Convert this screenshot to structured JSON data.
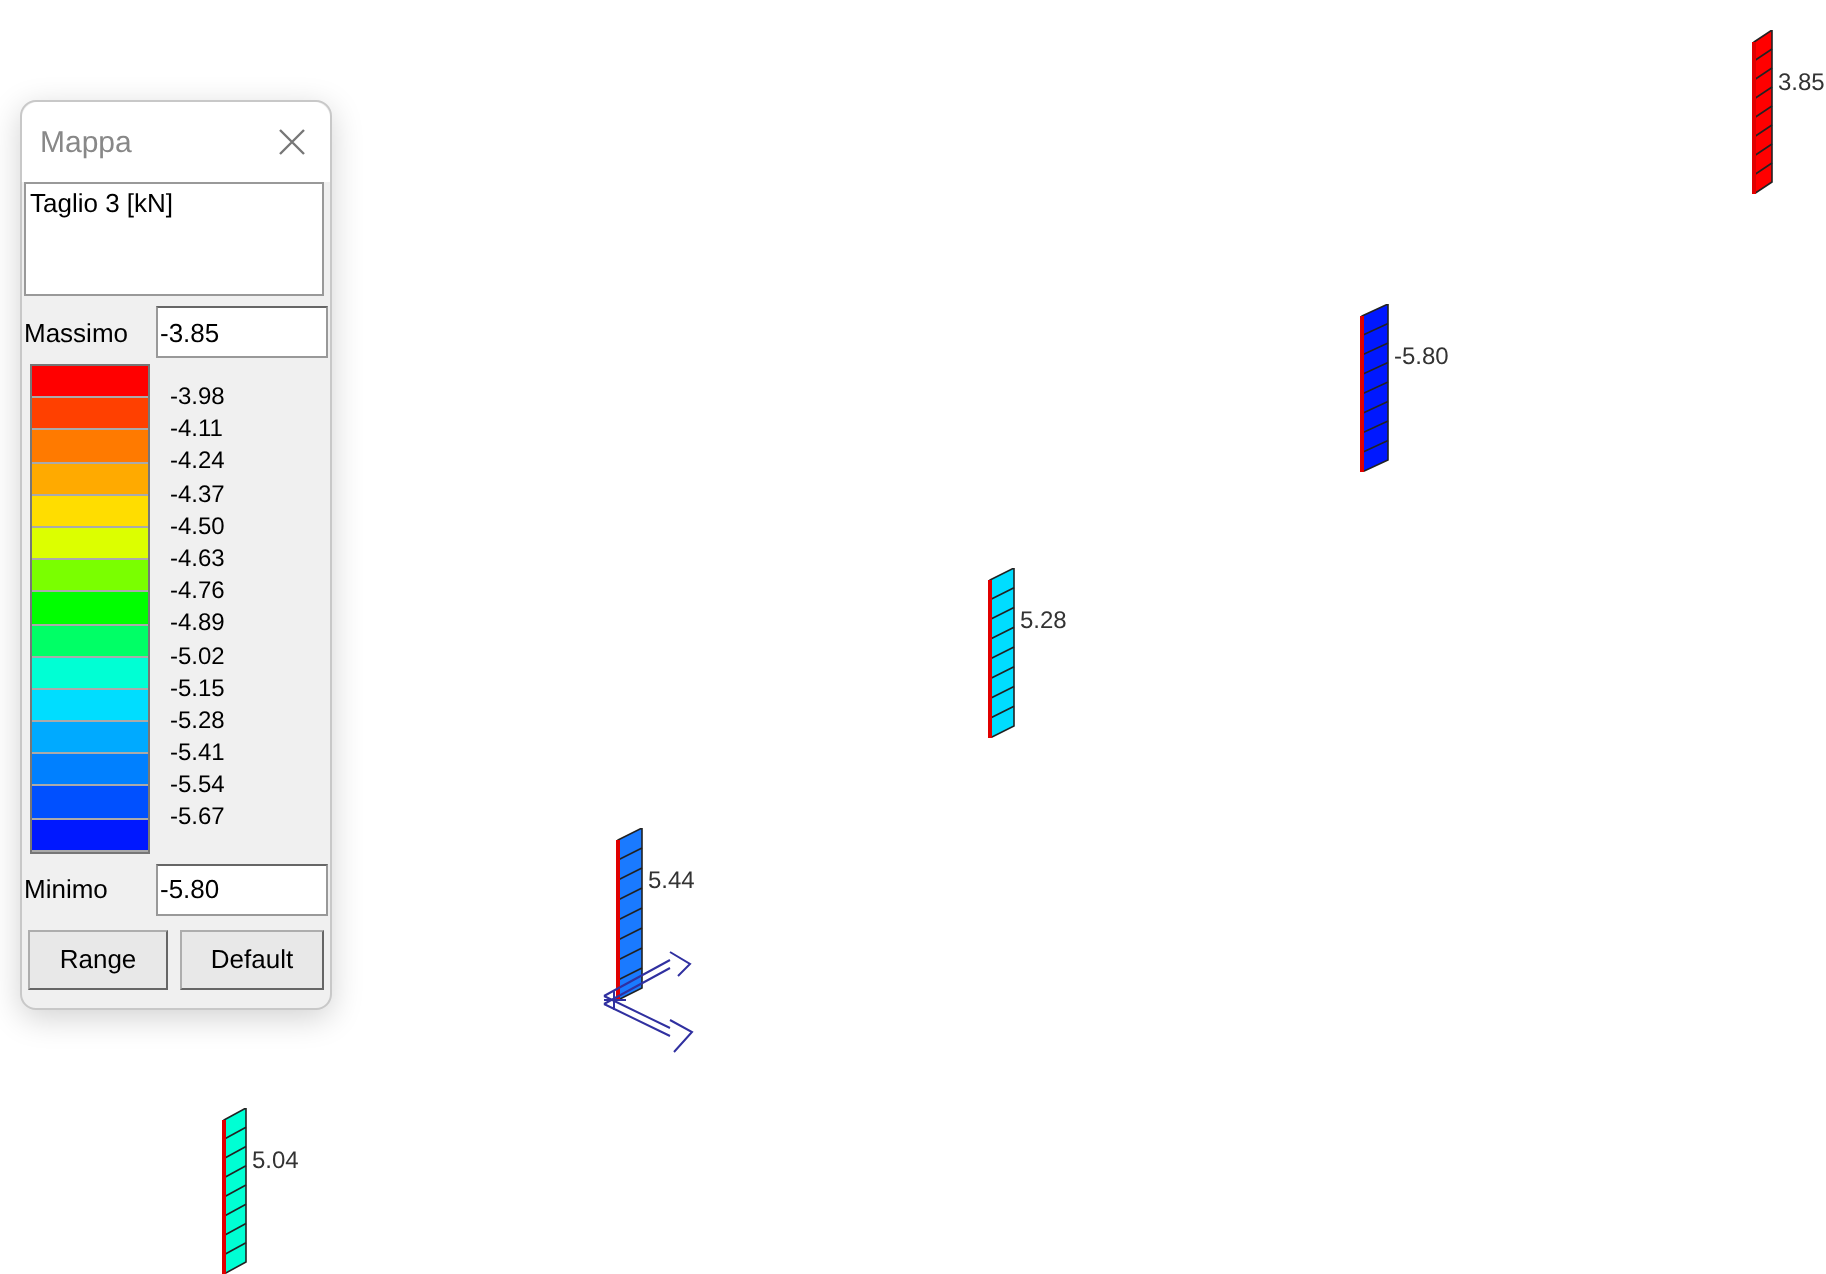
{
  "dialog": {
    "title": "Mappa",
    "quantity": "Taglio 3 [kN]",
    "maximum": {
      "label": "Massimo",
      "value": "-3.85"
    },
    "legend": {
      "bands": [
        {
          "color": "#ff0000"
        },
        {
          "color": "#ff4000"
        },
        {
          "color": "#ff7a00"
        },
        {
          "color": "#ffaa00"
        },
        {
          "color": "#ffdd00"
        },
        {
          "color": "#dcff00"
        },
        {
          "color": "#7aff00"
        },
        {
          "color": "#00ff00"
        },
        {
          "color": "#00ff66"
        },
        {
          "color": "#00ffd4"
        },
        {
          "color": "#00ddff"
        },
        {
          "color": "#00aaff"
        },
        {
          "color": "#0080ff"
        },
        {
          "color": "#0050ff"
        },
        {
          "color": "#0018ff"
        }
      ],
      "ticks": [
        "-3.98",
        "-4.11",
        "-4.24",
        "-4.37",
        "-4.50",
        "-4.63",
        "-4.76",
        "-4.89",
        "-5.02",
        "-5.15",
        "-5.28",
        "-5.41",
        "-5.54",
        "-5.67"
      ]
    },
    "minimum": {
      "label": "Minimo",
      "value": "-5.80"
    },
    "buttons": [
      "Range",
      "Default"
    ]
  },
  "members": [
    {
      "label": "3.85",
      "color": "#ff0000"
    },
    {
      "label": "-5.80",
      "color": "#0018ff"
    },
    {
      "label": "5.28",
      "color": "#00ddff"
    },
    {
      "label": "5.44",
      "color": "#1a7aff"
    },
    {
      "label": "5.04",
      "color": "#00ffd4"
    }
  ]
}
